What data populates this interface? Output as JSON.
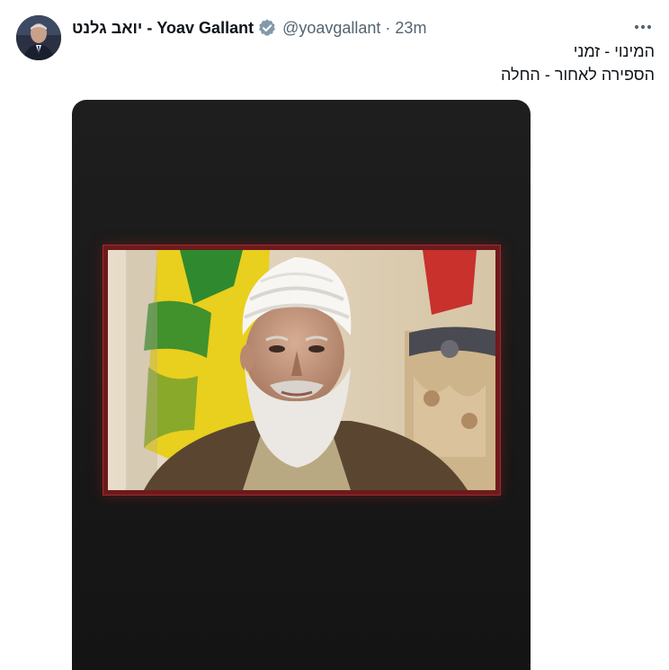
{
  "author": {
    "display_name": "יואב גלנט - Yoav Gallant",
    "handle": "@yoavgallant",
    "separator": "·",
    "time": "23m",
    "avatar": "avatar",
    "verified_icon": "verified-badge-icon"
  },
  "post": {
    "lines": [
      "המינוי - זמני",
      "הספירה לאחור - החלה"
    ]
  },
  "more_icon": "more-horizontal-icon",
  "media": {
    "subject": "photo"
  },
  "colors": {
    "text": "#0f1419",
    "secondary": "#536471",
    "verified": "#829aab",
    "media_bg": "#1a1a1a",
    "frame": "#6e1a1c"
  }
}
